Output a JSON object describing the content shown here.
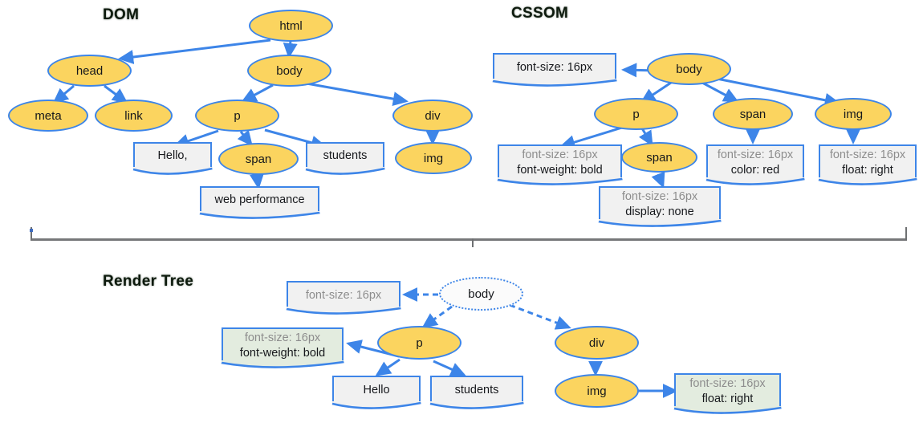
{
  "diagram": {
    "title_dom": "DOM",
    "title_cssom": "CSSOM",
    "title_render_tree": "Render Tree",
    "colors": {
      "node_fill": "#fbd45f",
      "node_stroke": "#3d85e8",
      "box_fill": "#f1f1f1",
      "box_fill_green": "#e3ecdf",
      "edge": "#3d85e8",
      "muted_text": "#8d8d8d",
      "text": "#16181c",
      "divider": "#77787a"
    }
  },
  "dom": {
    "nodes": [
      {
        "id": "html",
        "label": "html"
      },
      {
        "id": "head",
        "label": "head"
      },
      {
        "id": "body",
        "label": "body"
      },
      {
        "id": "meta",
        "label": "meta"
      },
      {
        "id": "link",
        "label": "link"
      },
      {
        "id": "p",
        "label": "p"
      },
      {
        "id": "div",
        "label": "div"
      },
      {
        "id": "span",
        "label": "span"
      },
      {
        "id": "img",
        "label": "img"
      }
    ],
    "boxes": [
      {
        "id": "hello",
        "line1": "Hello,"
      },
      {
        "id": "students",
        "line1": "students"
      },
      {
        "id": "webperf",
        "line1": "web performance"
      }
    ]
  },
  "cssom": {
    "nodes": [
      {
        "id": "body",
        "label": "body"
      },
      {
        "id": "p",
        "label": "p"
      },
      {
        "id": "span1",
        "label": "span"
      },
      {
        "id": "img",
        "label": "img"
      },
      {
        "id": "span2",
        "label": "span"
      }
    ],
    "boxes": [
      {
        "id": "body_rule",
        "line1": "font-size: 16px",
        "line1_muted": false,
        "line2": ""
      },
      {
        "id": "p_rule",
        "line1": "font-size: 16px",
        "line1_muted": true,
        "line2": "font-weight: bold"
      },
      {
        "id": "span1_rule",
        "line1": "font-size: 16px",
        "line1_muted": true,
        "line2": "color: red"
      },
      {
        "id": "img_rule",
        "line1": "font-size: 16px",
        "line1_muted": true,
        "line2": "float: right"
      },
      {
        "id": "span2_rule",
        "line1": "font-size: 16px",
        "line1_muted": true,
        "line2": "display: none"
      }
    ]
  },
  "render_tree": {
    "nodes": [
      {
        "id": "body",
        "label": "body",
        "ghost": true
      },
      {
        "id": "p",
        "label": "p",
        "ghost": false
      },
      {
        "id": "div",
        "label": "div",
        "ghost": false
      },
      {
        "id": "img",
        "label": "img",
        "ghost": false
      }
    ],
    "boxes": [
      {
        "id": "body_rule",
        "line1": "font-size: 16px",
        "line1_muted": true,
        "line2": "",
        "green": false
      },
      {
        "id": "p_rule",
        "line1": "font-size: 16px",
        "line1_muted": true,
        "line2": "font-weight: bold",
        "green": true
      },
      {
        "id": "hello",
        "line1": "Hello",
        "line1_muted": false,
        "line2": "",
        "green": false
      },
      {
        "id": "students",
        "line1": "students",
        "line1_muted": false,
        "line2": "",
        "green": false
      },
      {
        "id": "img_rule",
        "line1": "font-size: 16px",
        "line1_muted": true,
        "line2": "float: right",
        "green": true
      }
    ]
  }
}
